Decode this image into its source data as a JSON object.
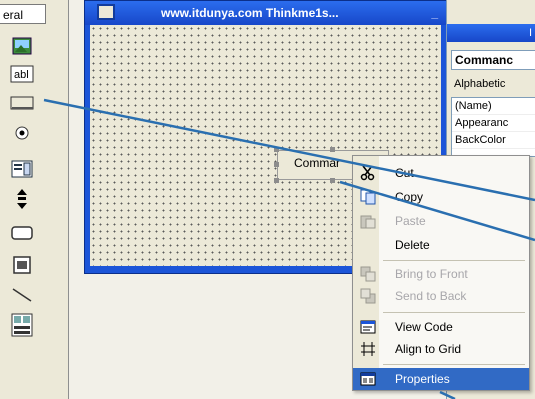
{
  "toolbox": {
    "header": "eral",
    "tools": [
      "picture",
      "textbox",
      "command-button",
      "option-button",
      "combobox",
      "scrollbar",
      "frame",
      "image",
      "line",
      "data"
    ]
  },
  "form_window": {
    "title": "www.itdunya.com Thinkme1s...",
    "min_glyph": "_"
  },
  "command_button": {
    "label": "Commar"
  },
  "properties": {
    "title": "I",
    "object_combo": "Commanc",
    "tab_alphabetic": "Alphabetic",
    "rows": [
      "(Name)",
      "Appearanc",
      "BackColor"
    ]
  },
  "context_menu": {
    "items": [
      {
        "label": "Cut",
        "enabled": true,
        "icon": "scissors-icon"
      },
      {
        "label": "Copy",
        "enabled": true,
        "icon": "copy-icon"
      },
      {
        "label": "Paste",
        "enabled": false,
        "icon": "paste-icon"
      },
      {
        "label": "Delete",
        "enabled": true,
        "icon": ""
      },
      {
        "label": "Bring to Front",
        "enabled": false,
        "icon": "bring-front-icon"
      },
      {
        "label": "Send to Back",
        "enabled": false,
        "icon": "send-back-icon"
      },
      {
        "label": "View Code",
        "enabled": true,
        "icon": "view-code-icon"
      },
      {
        "label": "Align to Grid",
        "enabled": true,
        "icon": "align-grid-icon"
      },
      {
        "label": "Properties",
        "enabled": true,
        "icon": "properties-icon",
        "highlighted": true
      }
    ]
  },
  "colors": {
    "title_blue": "#1c55d8",
    "highlight": "#316ac5",
    "annotation_line": "#2a6fb0"
  }
}
